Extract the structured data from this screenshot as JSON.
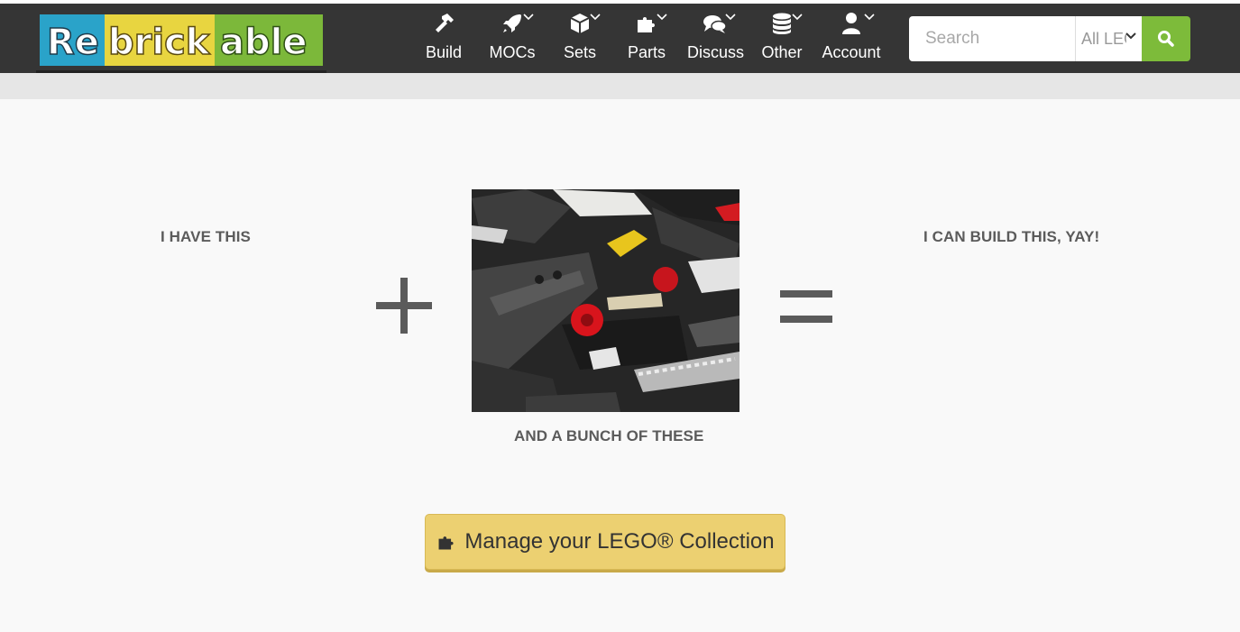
{
  "colors": {
    "navbar": "#353535",
    "search_button": "#7dbb3a",
    "cta_background": "#ecd071",
    "page_background": "#f9f9f9"
  },
  "logo": {
    "part1": "Re",
    "part2": "brick",
    "part3": "able"
  },
  "nav": [
    {
      "label": "Build",
      "icon": "hammer-icon",
      "has_dropdown": false
    },
    {
      "label": "MOCs",
      "icon": "rocket-icon",
      "has_dropdown": true
    },
    {
      "label": "Sets",
      "icon": "cube-icon",
      "has_dropdown": true
    },
    {
      "label": "Parts",
      "icon": "puzzle-icon",
      "has_dropdown": true
    },
    {
      "label": "Discuss",
      "icon": "comments-icon",
      "has_dropdown": true
    },
    {
      "label": "Other",
      "icon": "database-icon",
      "has_dropdown": true
    },
    {
      "label": "Account",
      "icon": "user-icon",
      "has_dropdown": true
    }
  ],
  "search": {
    "placeholder": "Search",
    "scope_value": "All LEGO"
  },
  "hero": {
    "left_label": "I HAVE THIS",
    "middle_label": "AND A BUNCH OF THESE",
    "right_label": "I CAN BUILD THIS, YAY!"
  },
  "cta": {
    "label": "Manage your LEGO® Collection",
    "icon": "puzzle-icon"
  }
}
